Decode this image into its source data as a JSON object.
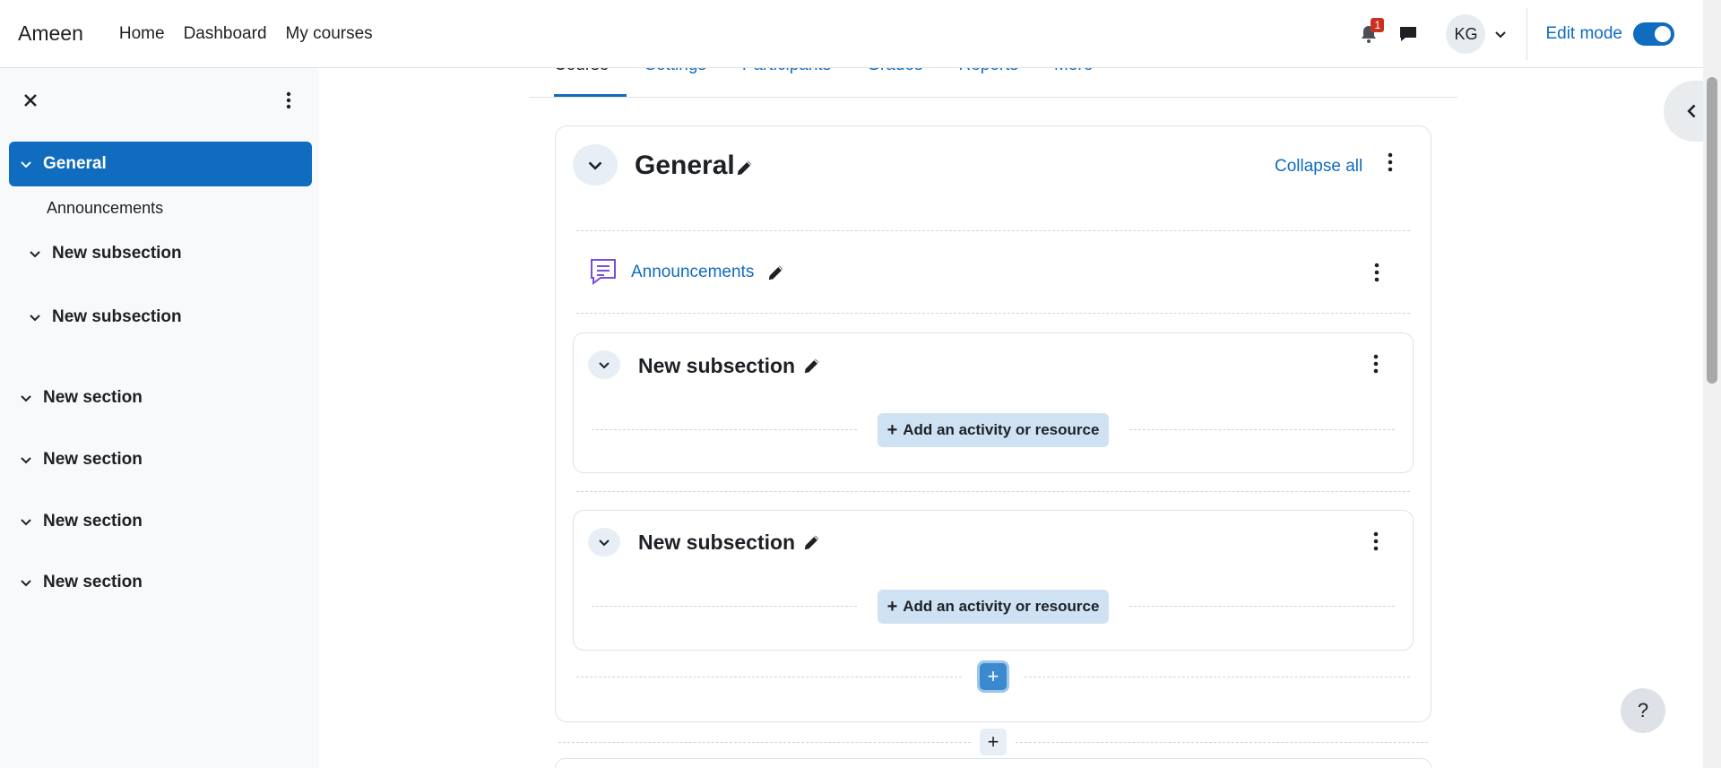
{
  "navbar": {
    "brand": "Ameen",
    "links": [
      "Home",
      "Dashboard",
      "My courses"
    ],
    "notification_count": "1",
    "avatar_initials": "KG",
    "edit_mode_label": "Edit mode",
    "edit_mode_on": true
  },
  "drawer": {
    "active_item": "General",
    "sub_items": [
      "Announcements"
    ],
    "subsections": [
      "New subsection",
      "New subsection"
    ],
    "sections": [
      "New section",
      "New section",
      "New section",
      "New section"
    ]
  },
  "tabs": [
    "Course",
    "Settings",
    "Participants",
    "Grades",
    "Reports",
    "More"
  ],
  "main": {
    "section_title": "General",
    "collapse_all": "Collapse all",
    "activity": "Announcements",
    "subsections": [
      {
        "title": "New subsection",
        "add_label": "Add an activity or resource"
      },
      {
        "title": "New subsection",
        "add_label": "Add an activity or resource"
      }
    ]
  },
  "help_label": "?",
  "icons": [
    "close-icon",
    "kebab-menu-icon",
    "chevron-down-icon",
    "pencil-icon",
    "bell-icon",
    "chat-icon",
    "forum-icon",
    "plus-icon",
    "chevron-left-icon"
  ],
  "colors": {
    "accent": "#0f6cbf",
    "badge": "#ca3120",
    "drawer_bg": "#f8f9fa"
  }
}
